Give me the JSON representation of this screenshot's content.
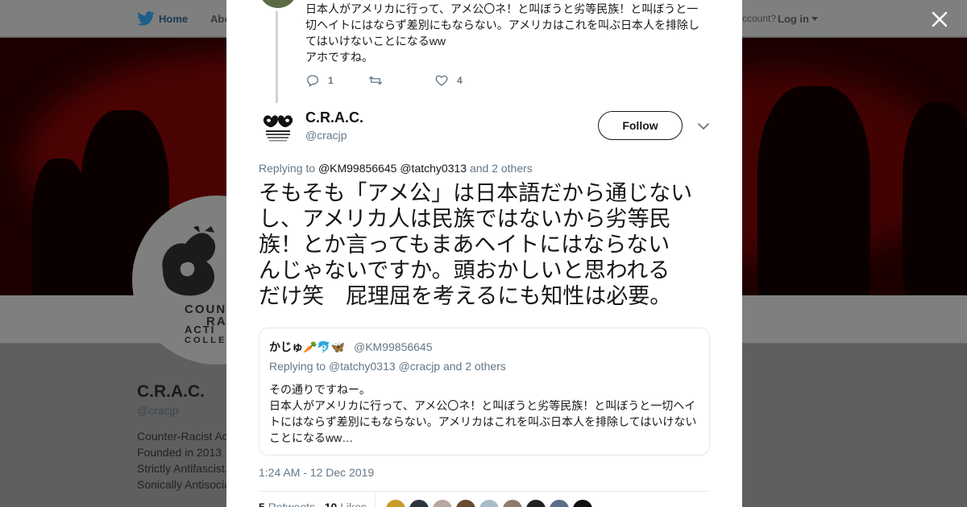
{
  "nav": {
    "home_label": "Home",
    "about_label": "Abo",
    "account_prompt": "ccount?",
    "login_label": "Log in"
  },
  "profile": {
    "name": "C.R.A.C.",
    "handle": "@cracjp",
    "bio_lines": [
      "Counter-Racist Ac",
      "Founded in 2013",
      "Strictly Antifascist.",
      "Sonically Antisocia"
    ],
    "logo_lines": [
      "COUN",
      "RACI",
      "ACTI",
      "COLLEC"
    ]
  },
  "previous_tweet": {
    "lines": [
      "日本人がアメリカに行って、アメ公〇ネ！と叫ぼうと劣等民族！と叫ぼうと一",
      "切ヘイトにはならず差別にもならない。アメリカはこれを叫ぶ日本人を排除し",
      "てはいけないことになるww",
      "アホですね。"
    ],
    "reply_count": "1",
    "like_count": "4"
  },
  "tweet": {
    "author_name": "C.R.A.C.",
    "author_handle": "@cracjp",
    "follow_label": "Follow",
    "replying_prefix": "Replying to",
    "replying_mention_1": "@KM99856645",
    "replying_mention_2": "@tatchy0313",
    "replying_suffix": "and 2 others",
    "text_lines": [
      "そもそも「アメ公」は日本語だから通じない",
      "し、アメリカ人は民族ではないから劣等民",
      "族！とか言ってもまあヘイトにはならない",
      "んじゃないですか。頭おかしいと思われる",
      "だけ笑　屁理屈を考えるにも知性は必要。"
    ],
    "timestamp": "1:24 AM - 12 Dec 2019",
    "retweets_count": "5",
    "retweets_label": "Retweets",
    "likes_count": "10",
    "likes_label": "Likes"
  },
  "quoted_tweet": {
    "author_name": "かじゅ🥕🐬🦋",
    "author_handle": "@KM99856645",
    "replying_text": "Replying to @tatchy0313 @cracjp and 2 others",
    "text_lines": [
      "その通りですねー。",
      "日本人がアメリカに行って、アメ公〇ネ！と叫ぼうと劣等民族！と叫ぼうと一切ヘイ",
      "トにはならず差別にもならない。アメリカはこれを叫ぶ日本人を排除してはいけない",
      "ことになるww…"
    ]
  },
  "colors": {
    "twitter_blue": "#1da1f2",
    "secondary_text": "#657786",
    "banner_red": "#4a0303"
  },
  "icons": {
    "nav_logo": "twitter-bird-icon",
    "close": "close-icon",
    "reply": "reply-icon",
    "retweet": "retweet-icon",
    "like": "heart-icon",
    "menu": "chevron-down-icon"
  },
  "liker_avatar_colors": [
    "#c79a2a",
    "#2c3440",
    "#b8a6a0",
    "#6b4a2c",
    "#a9bcc8",
    "#8b7d6b",
    "#222222",
    "#5a6e8a",
    "#111111"
  ]
}
